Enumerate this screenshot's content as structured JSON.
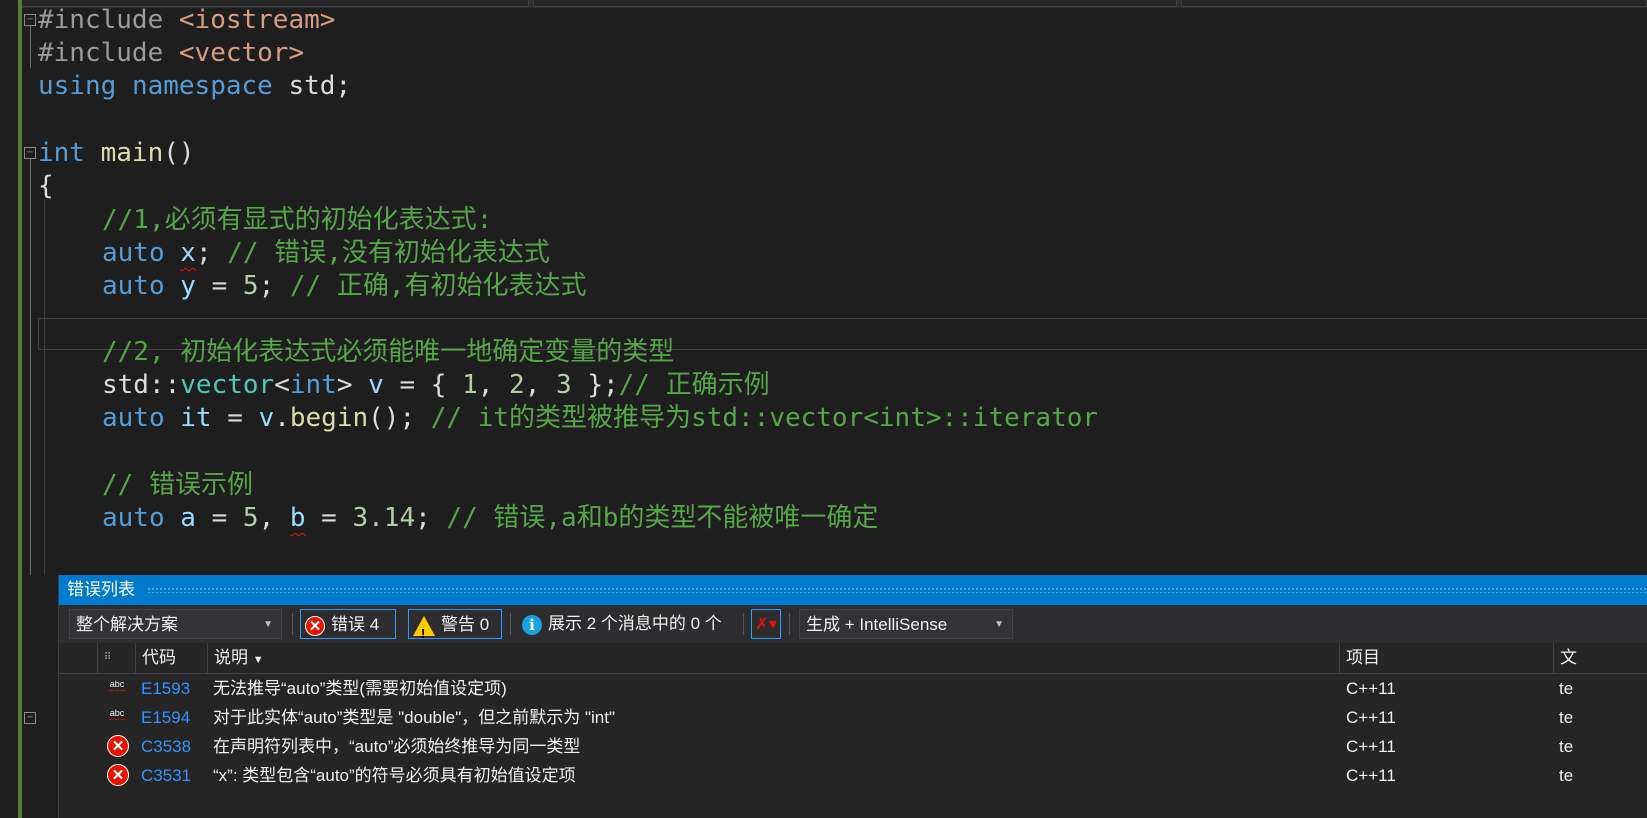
{
  "editor": {
    "lines": {
      "l1": {
        "pp": "#include ",
        "inc": "<iostream>"
      },
      "l2": {
        "pp": "#include ",
        "inc": "<vector>"
      },
      "l3": {
        "kw1": "using",
        "kw2": "namespace",
        "rest": " std;"
      },
      "l5": {
        "kw": "int",
        "fn": "main",
        "rest": "()"
      },
      "l6": {
        "text": "{"
      },
      "l7": {
        "comment": "//1,必须有显式的初始化表达式:"
      },
      "l8": {
        "kw": "auto",
        "var": "x",
        "rest": ";",
        "comment": " // 错误,没有初始化表达式"
      },
      "l9": {
        "kw": "auto",
        "var": "y",
        "op": " = ",
        "num": "5",
        "rest": ";",
        "comment": " // 正确,有初始化表达式"
      },
      "l11": {
        "comment": "//2, 初始化表达式必须能唯一地确定变量的类型"
      },
      "l12": {
        "ns": "std::",
        "ty": "vector",
        "lt": "<",
        "kw": "int",
        "gt": "> ",
        "var": "v",
        "op": " = { ",
        "n1": "1",
        "c1": ", ",
        "n2": "2",
        "c2": ", ",
        "n3": "3",
        "end": " };",
        "comment": "// 正确示例"
      },
      "l13": {
        "kw": "auto",
        "var": "it",
        "op": " = ",
        "var2": "v",
        "dot": ".",
        "fn": "begin",
        "rest": "(); ",
        "comment": "// it的类型被推导为std::vector<int>::iterator"
      },
      "l15": {
        "comment": "// 错误示例"
      },
      "l16": {
        "kw": "auto",
        "var": "a",
        "op": " = ",
        "num": "5",
        "c": ", ",
        "var2": "b",
        "op2": " = ",
        "num2": "3.14",
        "rest": "; ",
        "comment": "// 错误,a和b的类型不能被唯一确定"
      }
    }
  },
  "error_list": {
    "title": "错误列表",
    "scope_dropdown": "整个解决方案",
    "errors_toggle": "错误 4",
    "warnings_toggle": "警告 0",
    "messages_toggle": "展示 2 个消息中的 0 个",
    "build_dropdown": "生成 + IntelliSense",
    "columns": {
      "code": "代码",
      "description": "说明",
      "project": "项目",
      "file": "文"
    },
    "rows": [
      {
        "icon": "intellisense-error-icon",
        "code": "E1593",
        "description": "无法推导“auto”类型(需要初始值设定项)",
        "project": "C++11",
        "file": "te"
      },
      {
        "icon": "intellisense-error-icon",
        "code": "E1594",
        "description": "对于此实体“auto”类型是 \"double\"，但之前默示为 \"int\"",
        "project": "C++11",
        "file": "te"
      },
      {
        "icon": "build-error-icon",
        "code": "C3538",
        "description": "在声明符列表中，“auto”必须始终推导为同一类型",
        "project": "C++11",
        "file": "te"
      },
      {
        "icon": "build-error-icon",
        "code": "C3531",
        "description": "“x”: 类型包含“auto”的符号必须具有初始值设定项",
        "project": "C++11",
        "file": "te"
      }
    ]
  },
  "colors": {
    "keyword": "#569cd6",
    "comment": "#57a64a",
    "accent": "#007acc",
    "error": "#e51400"
  }
}
